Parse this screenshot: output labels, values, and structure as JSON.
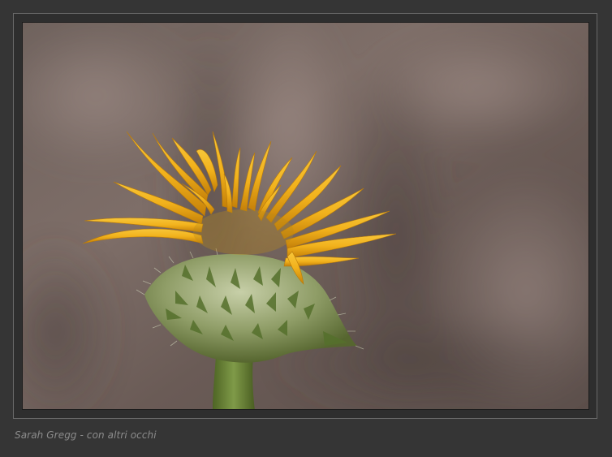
{
  "photo": {
    "subject": "yellow flower",
    "colors": {
      "background": "#353535",
      "petal": "#f0b21a",
      "petal_dark": "#c98a0c",
      "bud": "#9aa775",
      "stem": "#6f8a3a",
      "bokeh": "#7a6a62"
    }
  },
  "caption": {
    "text": "Sarah Gregg - con altri occhi"
  }
}
